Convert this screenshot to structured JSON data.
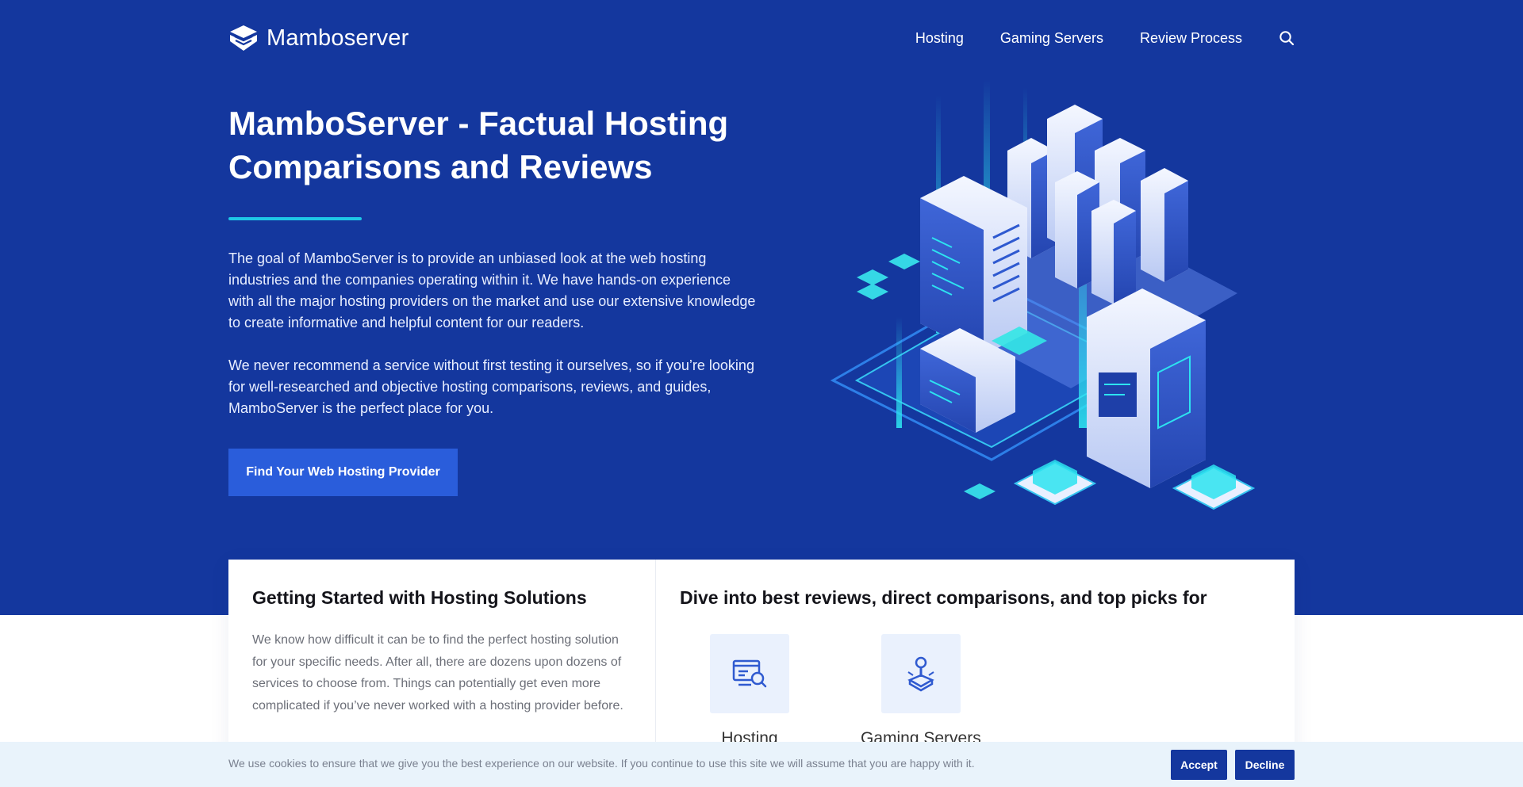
{
  "brand": {
    "name": "Mamboserver"
  },
  "nav": {
    "items": [
      {
        "label": "Hosting"
      },
      {
        "label": "Gaming Servers"
      },
      {
        "label": "Review Process"
      }
    ],
    "search_icon": "search-icon"
  },
  "hero": {
    "title": "MamboServer - Factual Hosting Comparisons and Reviews",
    "paragraph1": "The goal of MamboServer is to provide an unbiased look at the web hosting industries and the companies operating within it. We have hands-on experience with all the major hosting providers on the market and use our extensive knowledge to create informative and helpful content for our readers.",
    "paragraph2": "We never recommend a service without first testing it ourselves, so if you’re looking for well-researched and objective hosting comparisons, reviews, and guides, MamboServer is the perfect place for you.",
    "cta_label": "Find Your Web Hosting Provider"
  },
  "cards": {
    "left": {
      "title": "Getting Started with Hosting Solutions",
      "text": "We know how difficult it can be to find the perfect hosting solution for your specific needs. After all, there are dozens upon dozens of services to choose from. Things can potentially get even more complicated if you’ve never worked with a hosting provider before."
    },
    "right": {
      "title": "Dive into best reviews, direct comparisons, and top picks for",
      "categories": [
        {
          "label": "Hosting",
          "icon": "hosting-icon"
        },
        {
          "label": "Gaming Servers",
          "icon": "joystick-icon"
        }
      ]
    }
  },
  "cookie": {
    "text": "We use cookies to ensure that we give you the best experience on our website. If you continue to use this site we will assume that you are happy with it.",
    "accept_label": "Accept",
    "decline_label": "Decline"
  },
  "colors": {
    "hero_bg": "#14379e",
    "accent": "#1ec8e6",
    "cta_bg": "#2a5ddb",
    "cookie_bg": "#e9f3fb"
  }
}
